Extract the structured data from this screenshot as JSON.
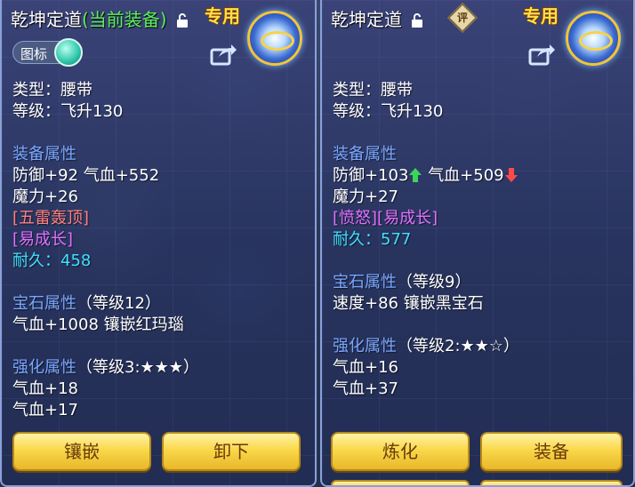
{
  "left_panel": {
    "title": "乾坤定道",
    "equipped_tag": "(当前装备)",
    "exclusive_label": "专用",
    "icon_toggle_label": "图标",
    "lines": {
      "type": "类型：腰带",
      "level": "等级：飞升130",
      "attr_header": "装备属性",
      "attr_1": "防御+92 气血+552",
      "attr_2": "魔力+26",
      "special_1": "[五雷轰顶]",
      "special_2": "[易成长]",
      "durability_label": "耐久：",
      "durability_value": "458",
      "gem_header": "宝石属性",
      "gem_level": "（等级12）",
      "gem_line": "气血+1008 镶嵌红玛瑙",
      "enh_header": "强化属性",
      "enh_level": "（等级3:★★★）",
      "enh_1": "气血+18",
      "enh_2": "气血+17"
    },
    "buttons": [
      "镶嵌",
      "卸下"
    ]
  },
  "right_panel": {
    "title": "乾坤定道",
    "rating_label": "评",
    "exclusive_label": "专用",
    "lines": {
      "type": "类型：腰带",
      "level": "等级：飞升130",
      "attr_header": "装备属性",
      "attr_1a": "防御+103",
      "attr_1b": "气血+509",
      "attr_2": "魔力+27",
      "special_1": "[愤怒][易成长]",
      "durability_label": "耐久：",
      "durability_value": "577",
      "gem_header": "宝石属性",
      "gem_level": "（等级9）",
      "gem_line": "速度+86 镶嵌黑宝石",
      "enh_header": "强化属性",
      "enh_level": "（等级2:★★☆）",
      "enh_1": "气血+16",
      "enh_2": "气血+37"
    },
    "buttons": [
      "炼化",
      "装备"
    ]
  },
  "colors": {
    "header_blue": "#7aa7ff",
    "special_red": "#ff8080",
    "special_purple": "#e070ff",
    "durability_cyan": "#40e0ff",
    "equipped_green": "#5cf05c",
    "button_gold": "#f9d84a"
  }
}
